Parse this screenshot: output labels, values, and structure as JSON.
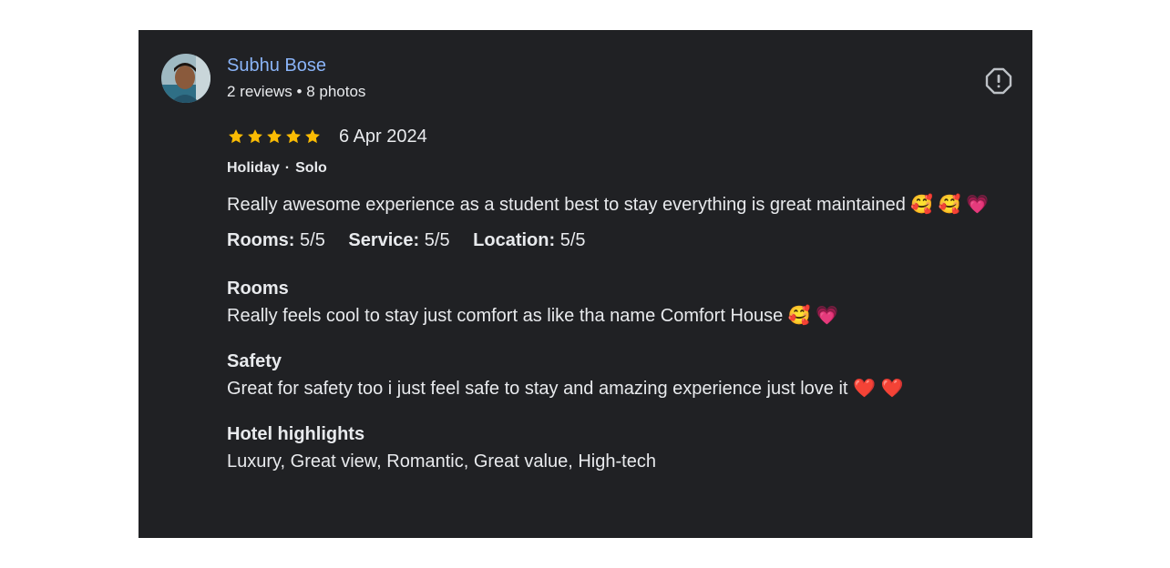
{
  "reviewer": {
    "name": "Subhu Bose",
    "meta": "2 reviews • 8 photos"
  },
  "review": {
    "rating": 5,
    "max_rating": 5,
    "date": "6 Apr 2024",
    "trip_type": "Holiday",
    "trip_separator": "·",
    "trip_group": "Solo",
    "text": "Really awesome experience as a student best to stay everything is great maintained 🥰 🥰 💗",
    "sub_ratings": [
      {
        "label": "Rooms:",
        "value": " 5/5"
      },
      {
        "label": "Service:",
        "value": " 5/5"
      },
      {
        "label": "Location:",
        "value": " 5/5"
      }
    ],
    "sections": [
      {
        "title": "Rooms",
        "text": "Really feels cool to stay just comfort as like tha name Comfort House 🥰 💗"
      },
      {
        "title": "Safety",
        "text": "Great for safety too i just feel safe to stay and amazing experience just love it ❤️ ❤️"
      },
      {
        "title": "Hotel highlights",
        "text": "Luxury, Great view, Romantic, Great value, High-tech"
      }
    ]
  },
  "icons": {
    "report": "report-flag-icon",
    "star": "star-icon"
  },
  "colors": {
    "card_background": "#202124",
    "name": "#8ab4f8",
    "star": "#fbbc04",
    "text": "#e8eaed"
  }
}
